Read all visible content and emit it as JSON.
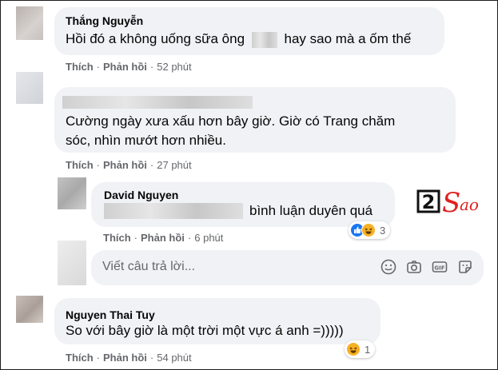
{
  "comments": [
    {
      "author": "Thắng Nguyễn",
      "text_before": "Hồi đó a không uống sữa ông",
      "text_after": "hay sao mà a ốm thế",
      "like_label": "Thích",
      "reply_label": "Phản hồi",
      "time": "52 phút"
    },
    {
      "text_line1": "Cường ngày xưa xấu hơn bây giờ. Giờ có Trang chăm",
      "text_line2": "sóc, nhìn mướt hơn nhiều.",
      "like_label": "Thích",
      "reply_label": "Phản hồi",
      "time": "27 phút"
    },
    {
      "author": "David Nguyen",
      "text_after": "bình luận duyên quá",
      "like_label": "Thích",
      "reply_label": "Phản hồi",
      "time": "6 phút",
      "reaction_count": "3"
    },
    {
      "author": "Nguyen Thai Tuy",
      "text": "So với bây giờ là một trời một vực á anh =)))))",
      "like_label": "Thích",
      "reply_label": "Phản hồi",
      "time": "54 phút",
      "reaction_count": "1"
    }
  ],
  "reply_box": {
    "placeholder": "Viết câu trả lời...",
    "icons": [
      "emoji-icon",
      "camera-icon",
      "gif-icon",
      "sticker-icon"
    ]
  },
  "watermark": {
    "text": "2Sao",
    "accent": "#e02020"
  },
  "colors": {
    "bubble": "#f0f2f5",
    "meta": "#65676b",
    "like": "#1877f2",
    "haha": "#f7b125"
  }
}
